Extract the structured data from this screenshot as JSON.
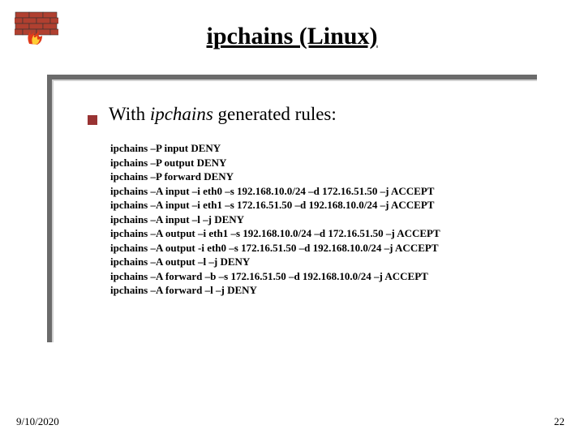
{
  "title": "ipchains (Linux)",
  "bullet": {
    "prefix": "With ",
    "italic": "ipchains",
    "suffix": " generated rules:"
  },
  "rules": [
    "ipchains –P input DENY",
    "ipchains –P output DENY",
    "ipchains –P forward DENY",
    "ipchains –A input –i eth0 –s 192.168.10.0/24 –d 172.16.51.50 –j ACCEPT",
    "ipchains –A input –i eth1 –s 172.16.51.50 –d 192.168.10.0/24 –j ACCEPT",
    "ipchains –A input –l –j DENY",
    "ipchains –A output –i eth1 –s 192.168.10.0/24 –d 172.16.51.50 –j ACCEPT",
    "ipchains –A output -i eth0 –s 172.16.51.50 –d 192.168.10.0/24 –j ACCEPT",
    "ipchains –A output –l –j DENY",
    "ipchains –A forward –b –s 172.16.51.50 –d 192.168.10.0/24 –j ACCEPT",
    "ipchains –A forward –l –j DENY"
  ],
  "footer": {
    "date": "9/10/2020",
    "page": "22"
  }
}
